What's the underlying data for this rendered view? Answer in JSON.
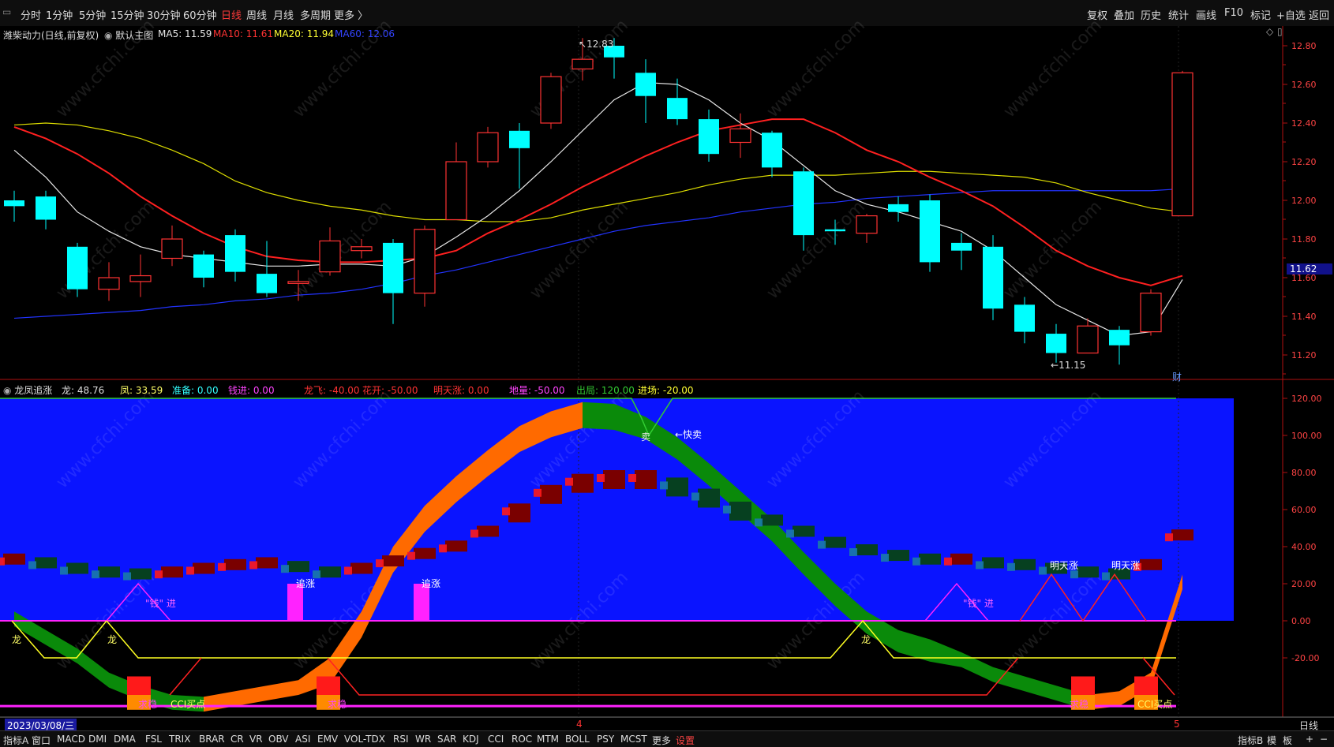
{
  "toolbar": {
    "timeframes": [
      "分时",
      "1分钟",
      "5分钟",
      "15分钟",
      "30分钟",
      "60分钟",
      "日线",
      "周线",
      "月线",
      "多周期",
      "更多 〉"
    ],
    "active": "日线",
    "right_tools": [
      "复权",
      "叠加",
      "历史",
      "统计",
      "画线",
      "F10",
      "标记",
      "+自选",
      "返回"
    ]
  },
  "main_panel": {
    "stock": "潍柴动力(日线,前复权)",
    "template": "默认主图",
    "ma5": "MA5: 11.59",
    "ma10": "MA10: 11.61",
    "ma20": "MA20: 11.94",
    "ma60": "MA60: 12.06",
    "high_label": "12.83",
    "low_label": "11.15",
    "current_price": "11.62",
    "fin_marker": "财",
    "price_ticks": [
      "12.80",
      "12.60",
      "12.40",
      "12.20",
      "12.00",
      "11.80",
      "11.60",
      "11.40",
      "11.20"
    ]
  },
  "indicator_panel": {
    "name": "龙凤追涨",
    "values": [
      {
        "text": "龙: 48.76",
        "color": "#dddddd"
      },
      {
        "text": "凤: 33.59",
        "color": "#ffff66"
      },
      {
        "text": "准备: 0.00",
        "color": "#33ffff"
      },
      {
        "text": "钱进: 0.00",
        "color": "#ff44ff"
      },
      {
        "text": "龙飞: -40.00",
        "color": "#ff3333"
      },
      {
        "text": "花开: -50.00",
        "color": "#ff3333"
      },
      {
        "text": "明天涨: 0.00",
        "color": "#ff3333"
      },
      {
        "text": "地量: -50.00",
        "color": "#ff44ff"
      },
      {
        "text": "出局: 120.00",
        "color": "#33cc33"
      },
      {
        "text": "进场: -20.00",
        "color": "#ffff33"
      }
    ],
    "ticks": [
      "120.00",
      "100.00",
      "80.00",
      "60.00",
      "40.00",
      "20.00",
      "0.00",
      "-20.00"
    ],
    "annotations": {
      "quick_sell": "←快卖",
      "sell_char": "卖",
      "chase1": "追涨",
      "chase2": "追涨",
      "money_in": "\"钱\" 进",
      "long": "龙",
      "tomorrow": "明天涨",
      "bottom_hold": "求稳",
      "cci": "CCI买点"
    }
  },
  "dates": {
    "start": "2023/03/08/三",
    "m4": "4",
    "m5": "5"
  },
  "bottom": {
    "left": [
      "指标A",
      "窗口",
      "MACD",
      "DMI",
      "DMA",
      "FSL",
      "TRIX",
      "BRAR",
      "CR",
      "VR",
      "OBV",
      "ASI",
      "EMV",
      "VOL-TDX",
      "RSI",
      "WR",
      "SAR",
      "KDJ",
      "CCI",
      "ROC",
      "MTM",
      "BOLL",
      "PSY",
      "MCST",
      "更多",
      "设置"
    ],
    "right": [
      "指标B",
      "模",
      "板",
      "+",
      "−"
    ],
    "period": "日线"
  },
  "watermark": "www.cfchi.com",
  "colors": {
    "up": "#ff3333",
    "down": "#00ffff",
    "ma5": "#e6e6e6",
    "ma10": "#ff2020",
    "ma20": "#dddd00",
    "ma60": "#2233ff",
    "panel_bg": "#0a14ff",
    "axis": "#b01010"
  }
}
